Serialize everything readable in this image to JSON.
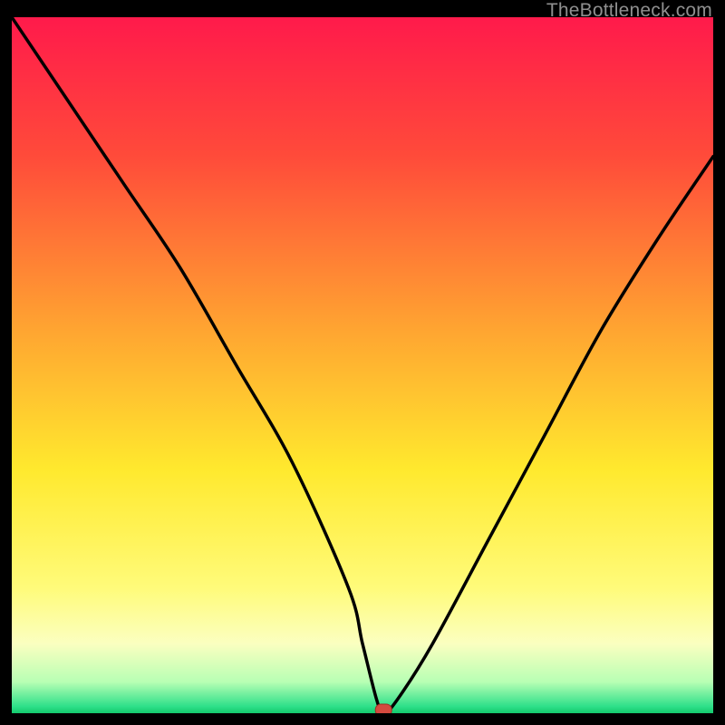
{
  "watermark": "TheBottleneck.com",
  "chart_data": {
    "type": "line",
    "title": "",
    "xlabel": "",
    "ylabel": "",
    "xlim": [
      0,
      100
    ],
    "ylim": [
      0,
      100
    ],
    "x": [
      0,
      8,
      16,
      24,
      32,
      40,
      48,
      50,
      52,
      53,
      55,
      60,
      68,
      76,
      84,
      92,
      100
    ],
    "values": [
      100,
      88,
      76,
      64,
      50,
      36,
      18,
      10,
      2,
      0,
      2,
      10,
      25,
      40,
      55,
      68,
      80
    ],
    "marker": {
      "x": 53,
      "y": 0,
      "color": "#d44a3f"
    },
    "gradient_stops": [
      {
        "pos": 0.0,
        "color": "#ff1a4b"
      },
      {
        "pos": 0.2,
        "color": "#ff4b3a"
      },
      {
        "pos": 0.45,
        "color": "#ffa531"
      },
      {
        "pos": 0.65,
        "color": "#ffe92e"
      },
      {
        "pos": 0.82,
        "color": "#fffb7a"
      },
      {
        "pos": 0.9,
        "color": "#fbffc0"
      },
      {
        "pos": 0.955,
        "color": "#b8ffb4"
      },
      {
        "pos": 0.99,
        "color": "#2fe08a"
      },
      {
        "pos": 1.0,
        "color": "#13c96d"
      }
    ]
  }
}
